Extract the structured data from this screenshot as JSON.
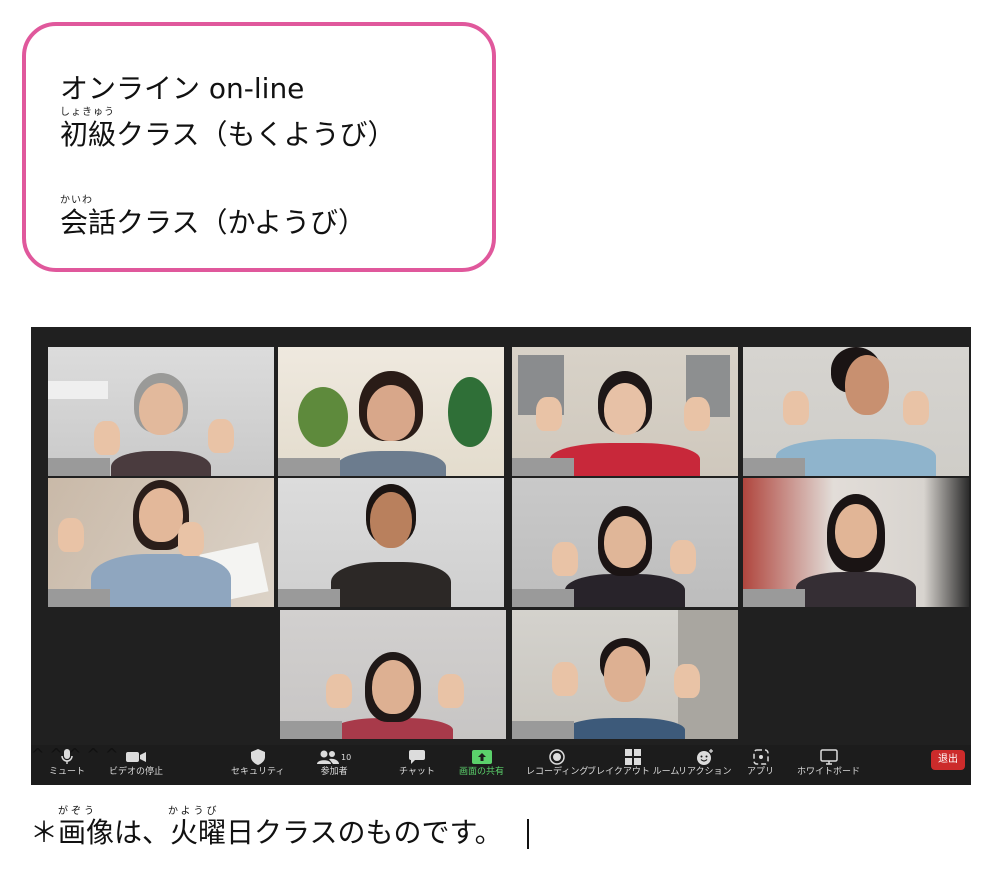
{
  "card": {
    "line1": "オンライン on-line",
    "ruby_shokyu": "しょきゅう",
    "line2": "初級クラス（もくようび）",
    "ruby_kaiwa": "かいわ",
    "line3": "会話クラス（かようび）",
    "border_color": "#e0589c"
  },
  "zoom": {
    "toolbar": {
      "mute": "ミュート",
      "video": "ビデオの停止",
      "security": "セキュリティ",
      "participants": "参加者",
      "participants_count": "10",
      "chat": "チャット",
      "share": "画面の共有",
      "record": "レコーディング",
      "breakout": "ブレイクアウト ルーム",
      "reactions": "リアクション",
      "apps": "アプリ",
      "whiteboard": "ホワイトボード",
      "leave": "退出"
    },
    "participant_count_tiles": 10,
    "accent_active_speaker": "#c8e86a",
    "share_color": "#5bd16b",
    "leave_color": "#cc2b2b"
  },
  "caption": {
    "ruby_gazou": "がぞう",
    "ruby_kayoubi": "かようび",
    "text": "＊画像は、火曜日クラスのものです。"
  }
}
